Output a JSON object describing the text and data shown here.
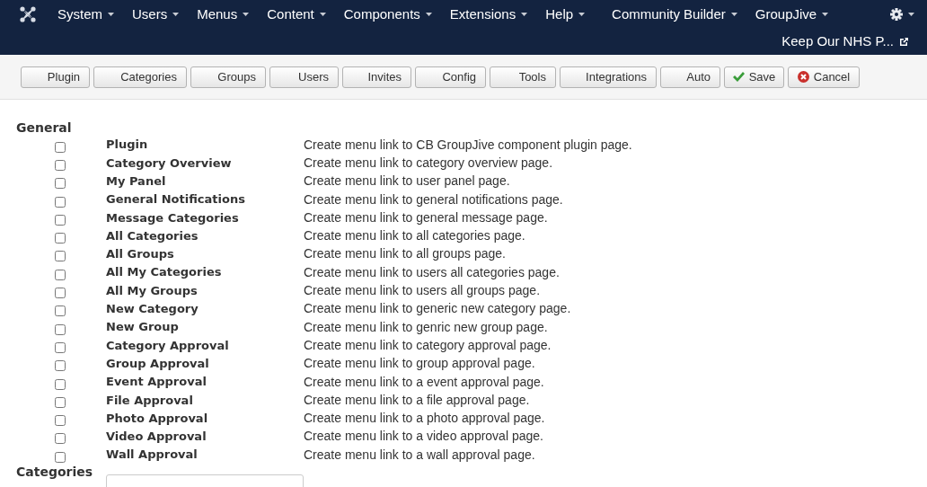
{
  "menu": [
    {
      "label": "System"
    },
    {
      "label": "Users"
    },
    {
      "label": "Menus"
    },
    {
      "label": "Content"
    },
    {
      "label": "Components"
    },
    {
      "label": "Extensions"
    },
    {
      "label": "Help"
    },
    {
      "label": "Community Builder"
    },
    {
      "label": "GroupJive"
    }
  ],
  "site_link": "Keep Our NHS P...",
  "toolbar": [
    {
      "label": "Plugin",
      "kind": "plain"
    },
    {
      "label": "Categories",
      "kind": "plain"
    },
    {
      "label": "Groups",
      "kind": "plain"
    },
    {
      "label": "Users",
      "kind": "plain"
    },
    {
      "label": "Invites",
      "kind": "plain"
    },
    {
      "label": "Config",
      "kind": "plain"
    },
    {
      "label": "Tools",
      "kind": "plain"
    },
    {
      "label": "Integrations",
      "kind": "plain"
    },
    {
      "label": "Auto",
      "kind": "plain"
    },
    {
      "label": "Save",
      "kind": "save"
    },
    {
      "label": "Cancel",
      "kind": "cancel"
    }
  ],
  "sections": [
    {
      "title": "General",
      "items": [
        {
          "label": "Plugin",
          "description": "Create menu link to CB GroupJive component plugin page.",
          "checked": false
        },
        {
          "label": "Category Overview",
          "description": "Create menu link to category overview page.",
          "checked": false
        },
        {
          "label": "My Panel",
          "description": "Create menu link to user panel page.",
          "checked": false
        },
        {
          "label": "General Notifications",
          "description": "Create menu link to general notifications page.",
          "checked": false
        },
        {
          "label": "Message Categories",
          "description": "Create menu link to general message page.",
          "checked": false
        },
        {
          "label": "All Categories",
          "description": "Create menu link to all categories page.",
          "checked": false
        },
        {
          "label": "All Groups",
          "description": "Create menu link to all groups page.",
          "checked": false
        },
        {
          "label": "All My Categories",
          "description": "Create menu link to users all categories page.",
          "checked": false
        },
        {
          "label": "All My Groups",
          "description": "Create menu link to users all groups page.",
          "checked": false
        },
        {
          "label": "New Category",
          "description": "Create menu link to generic new category page.",
          "checked": false
        },
        {
          "label": "New Group",
          "description": "Create menu link to genric new group page.",
          "checked": false
        },
        {
          "label": "Category Approval",
          "description": "Create menu link to category approval page.",
          "checked": false
        },
        {
          "label": "Group Approval",
          "description": "Create menu link to group approval page.",
          "checked": false
        },
        {
          "label": "Event Approval",
          "description": "Create menu link to a event approval page.",
          "checked": false
        },
        {
          "label": "File Approval",
          "description": "Create menu link to a file approval page.",
          "checked": false
        },
        {
          "label": "Photo Approval",
          "description": "Create menu link to a photo approval page.",
          "checked": false
        },
        {
          "label": "Video Approval",
          "description": "Create menu link to a video approval page.",
          "checked": false
        },
        {
          "label": "Wall Approval",
          "description": "Create menu link to a wall approval page.",
          "checked": false
        }
      ]
    },
    {
      "title": "Categories",
      "kind": "select"
    }
  ]
}
